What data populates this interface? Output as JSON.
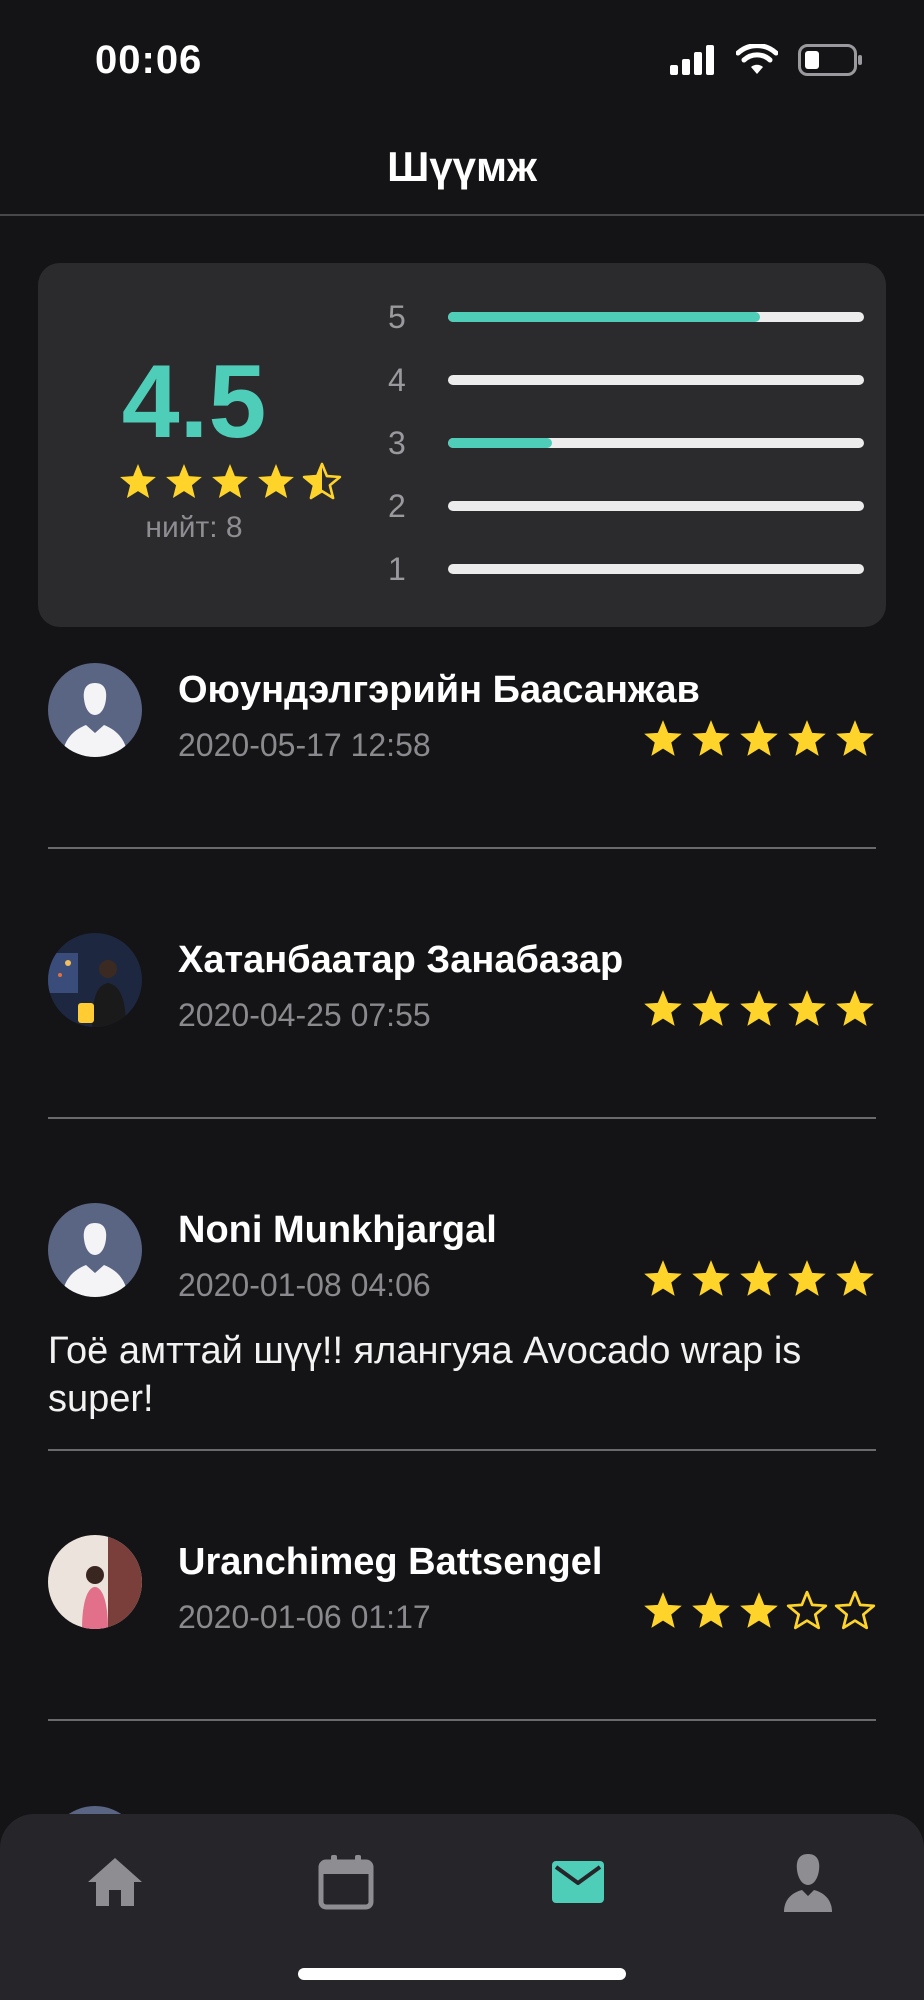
{
  "status_bar": {
    "time": "00:06"
  },
  "header": {
    "title": "Шүүмж"
  },
  "summary": {
    "average": "4.5",
    "average_stars": 4.5,
    "total_label": "нийт: 8",
    "bars": [
      {
        "label": "5",
        "fraction": 0.75
      },
      {
        "label": "4",
        "fraction": 0
      },
      {
        "label": "3",
        "fraction": 0.25
      },
      {
        "label": "2",
        "fraction": 0
      },
      {
        "label": "1",
        "fraction": 0
      }
    ]
  },
  "reviews": [
    {
      "name": "Оюундэлгэрийн Баасанжав",
      "date": "2020-05-17 12:58",
      "rating": 5,
      "comment": "",
      "avatar": "placeholder"
    },
    {
      "name": "Хатанбаатар Занабазар",
      "date": "2020-04-25 07:55",
      "rating": 5,
      "comment": "",
      "avatar": "photo-night"
    },
    {
      "name": "Noni Munkhjargal",
      "date": "2020-01-08 04:06",
      "rating": 5,
      "comment": "Гоё амттай шүү!! ялангуяа Avocado wrap is super!",
      "avatar": "placeholder"
    },
    {
      "name": "Uranchimeg Battsengel",
      "date": "2020-01-06 01:17",
      "rating": 3,
      "comment": "",
      "avatar": "photo-light"
    }
  ],
  "tabs": [
    {
      "name": "home",
      "icon": "home-icon",
      "active": false
    },
    {
      "name": "calendar",
      "icon": "calendar-icon",
      "active": false
    },
    {
      "name": "messages",
      "icon": "mail-icon",
      "active": true
    },
    {
      "name": "profile",
      "icon": "user-icon",
      "active": false
    }
  ],
  "colors": {
    "accent": "#4ecdb8",
    "star": "#ffd42a",
    "background": "#141416",
    "card": "#2b2b2e"
  }
}
